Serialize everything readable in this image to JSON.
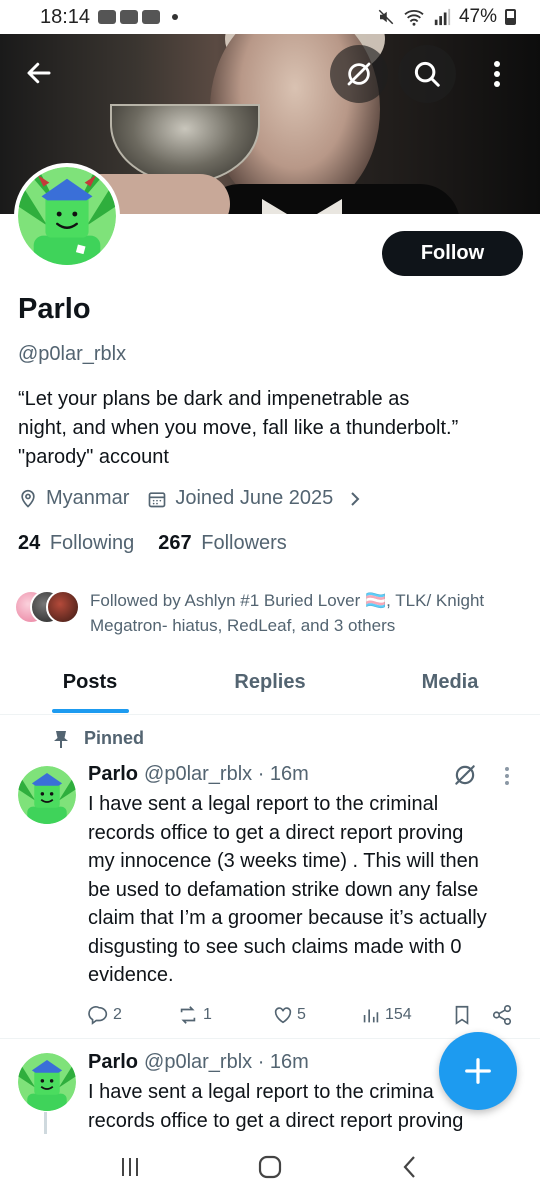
{
  "status_bar": {
    "time": "18:14",
    "battery": "47%"
  },
  "profile": {
    "name": "Parlo",
    "handle": "@p0lar_rblx",
    "bio_line1": "“Let your plans be dark and impenetrable as",
    "bio_line2": "night, and when you move, fall like a thunderbolt.”",
    "bio_line3": "\"parody\" account",
    "location": "Myanmar",
    "joined": "Joined June 2025",
    "following_count": "24",
    "following_label": "Following",
    "followers_count": "267",
    "followers_label": "Followers",
    "follow_button": "Follow",
    "followed_by_line1": "Followed by Ashlyn #1 Buried Lover 🏳️‍⚧️, TLK/ Knight",
    "followed_by_line2": "Megatron- hiatus, RedLeaf, and 3 others"
  },
  "tabs": [
    "Posts",
    "Replies",
    "Media"
  ],
  "pinned_label": "Pinned",
  "posts": [
    {
      "name": "Parlo",
      "meta": "@p0lar_rblx · 16m",
      "lines": [
        "I have sent a legal report to the criminal",
        "records office to get a direct report proving",
        "my innocence (3 weeks time) . This will then",
        "be used to defamation strike down any false",
        "claim that I’m a groomer because it’s actually",
        "disgusting to see such claims made with 0",
        "evidence."
      ],
      "replies": "2",
      "reposts": "1",
      "likes": "5",
      "views": "154"
    },
    {
      "name": "Parlo",
      "meta": "@p0lar_rblx · 16m",
      "lines": [
        "I have sent a legal report to the crimina",
        "records office to get a direct report proving"
      ]
    }
  ],
  "colors": {
    "accent": "#1d9bf0",
    "text_primary": "#0f1419",
    "text_secondary": "#536471",
    "avatar_green": "#3fd35a"
  }
}
